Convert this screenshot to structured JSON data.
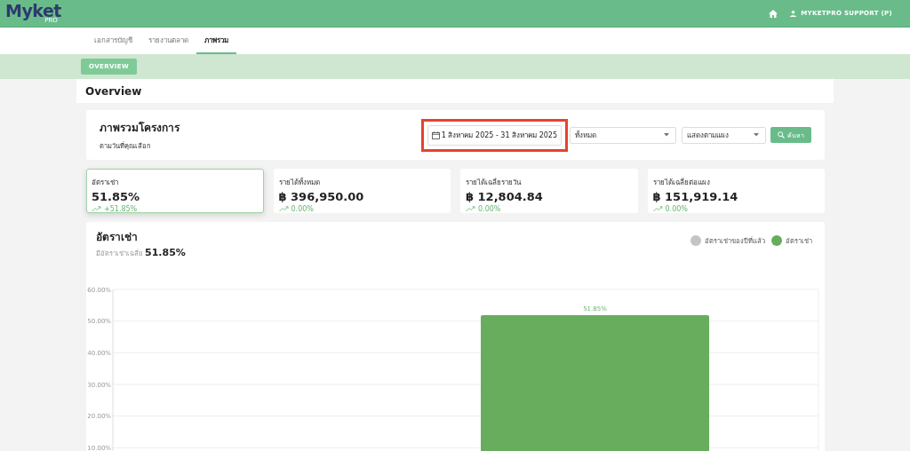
{
  "header": {
    "logo": {
      "name": "Myket",
      "badge": "PRO"
    },
    "user": "MYKETPRO SUPPORT (P)"
  },
  "tabs": [
    {
      "label": "เอกสารบัญชี",
      "selected": false
    },
    {
      "label": "รายงานตลาด",
      "selected": false
    },
    {
      "label": "ภาพรวม",
      "selected": true
    }
  ],
  "subnav": {
    "button": "OVERVIEW"
  },
  "page_title": "Overview",
  "project": {
    "title": "ภาพรวมโครงการ",
    "subtitle": "ตามวันที่คุณเลือก",
    "date_range": {
      "value": "1 สิงหาคม 2025 - 31 สิงหาคม 2025",
      "highlighted": true
    },
    "filters": [
      {
        "value": "ทั้งหมด"
      },
      {
        "value": "แสดงตามแผง"
      }
    ],
    "search_button": "ค้นหา"
  },
  "stats": [
    {
      "label": "อัตราเช่า",
      "value": "51.85%",
      "change": "+51.85%",
      "selected": true
    },
    {
      "label": "รายได้ทั้งหมด",
      "value": "฿ 396,950.00",
      "change": "0.00%",
      "selected": false
    },
    {
      "label": "รายได้เฉลี่ยรายวัน",
      "value": "฿ 12,804.84",
      "change": "0.00%",
      "selected": false
    },
    {
      "label": "รายได้เฉลี่ยต่อแผง",
      "value": "฿ 151,919.14",
      "change": "0.00%",
      "selected": false
    }
  ],
  "occupancy": {
    "title": "อัตราเช่า",
    "average_label": "มีอัตราเช่าเฉลี่ย",
    "average_value": "51.85%",
    "chart_data": {
      "type": "bar",
      "grid": true,
      "ylim": [
        0,
        60
      ],
      "yticks": [
        {
          "value": 10,
          "label": "10.00%"
        },
        {
          "value": 20,
          "label": "20.00%"
        },
        {
          "value": 30,
          "label": "30.00%"
        },
        {
          "value": 40,
          "label": "40.00%"
        },
        {
          "value": 50,
          "label": "50.00%"
        },
        {
          "value": 60,
          "label": "60.00%"
        }
      ],
      "series": [
        {
          "name": "อัตราเช่าของปีที่แล้ว",
          "color": "#c4c4c4",
          "values": [
            null
          ]
        },
        {
          "name": "อัตราเช่า",
          "color": "#68ad5d",
          "values": [
            51.85
          ]
        }
      ],
      "value_labels": [
        "51.85%"
      ]
    }
  }
}
